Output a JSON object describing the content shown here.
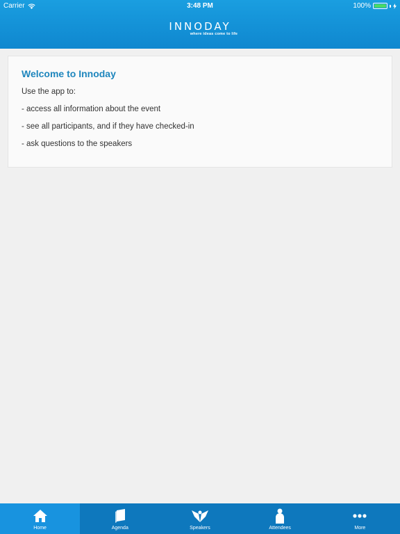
{
  "status_bar": {
    "carrier": "Carrier",
    "time": "3:48 PM",
    "battery": "100%"
  },
  "header": {
    "logo_text": "INNODAY",
    "tagline": "where ideas come to life"
  },
  "card": {
    "title": "Welcome to Innoday",
    "lines": [
      "Use the app to:",
      "- access all information about the event",
      "- see all participants, and if they have checked-in",
      "- ask questions to the speakers"
    ]
  },
  "tabs": [
    {
      "label": "Home",
      "icon": "home-icon",
      "active": true
    },
    {
      "label": "Agenda",
      "icon": "book-icon",
      "active": false
    },
    {
      "label": "Speakers",
      "icon": "speaker-icon",
      "active": false
    },
    {
      "label": "Attendees",
      "icon": "person-icon",
      "active": false
    },
    {
      "label": "More",
      "icon": "more-icon",
      "active": false
    }
  ],
  "colors": {
    "header": "#1a9ee0",
    "tabbar": "#0e78bd",
    "tab_active": "#1893df",
    "title": "#1e86bd",
    "battery": "#4cd964"
  }
}
